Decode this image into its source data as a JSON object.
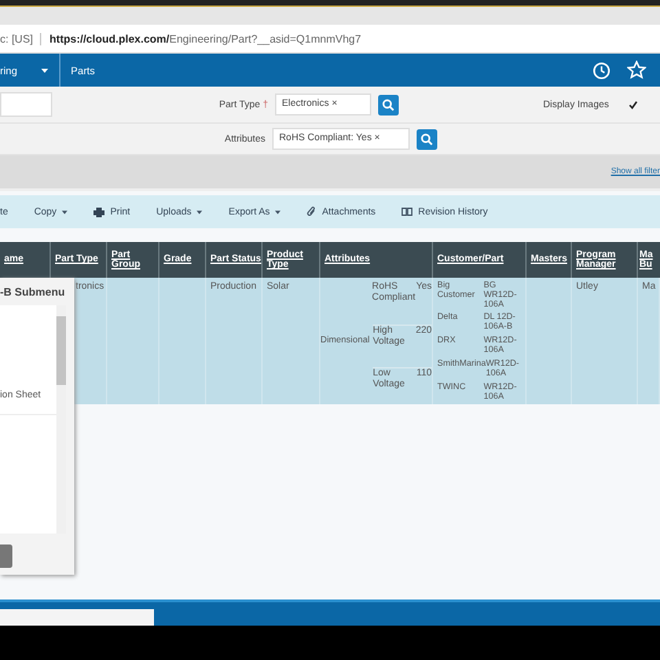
{
  "address_bar": {
    "prefix": "c: [US]",
    "url_host": "https://cloud.plex.com/",
    "url_path": "Engineering/Part?__asid=Q1mnmVhg7"
  },
  "nav": {
    "items": [
      {
        "label": "ring",
        "dropdown": true
      },
      {
        "label": "Parts",
        "dropdown": false
      }
    ]
  },
  "filters": {
    "part_type": {
      "label": "Part Type",
      "required_mark": "†",
      "value": "Electronics",
      "remove_mark": "×"
    },
    "attributes": {
      "label": "Attributes",
      "value": "RoHS Compliant: Yes",
      "remove_mark": "×"
    },
    "display_images": {
      "label": "Display Images",
      "checked": true
    }
  },
  "show_all_filters": "Show all filter",
  "toolbar": [
    {
      "label": "te",
      "dropdown": false,
      "kind": "plain"
    },
    {
      "label": "Copy",
      "dropdown": true,
      "kind": "plain"
    },
    {
      "label": "Print",
      "dropdown": false,
      "kind": "print"
    },
    {
      "label": "Uploads",
      "dropdown": true,
      "kind": "plain"
    },
    {
      "label": "Export As",
      "dropdown": true,
      "kind": "plain"
    },
    {
      "label": "Attachments",
      "dropdown": false,
      "kind": "attach"
    },
    {
      "label": "Revision History",
      "dropdown": false,
      "kind": "history"
    }
  ],
  "table": {
    "columns": [
      "ame",
      "Part Type",
      "Part Group",
      "Grade",
      "Part Status",
      "Product Type",
      "Attributes",
      "Customer/Part",
      "Masters",
      "Program Manager",
      "Ma Bu"
    ],
    "rows": [
      {
        "part_type": "tronics",
        "part_status": "Production",
        "product_type": "Solar",
        "attributes": [
          {
            "name": "RoHS Compliant",
            "value": "Yes"
          },
          {
            "group": "Dimensional",
            "name": "High Voltage",
            "value": "220"
          },
          {
            "name": "Low Voltage",
            "value": "110"
          }
        ],
        "customers": [
          {
            "customer": "Big Customer",
            "part": "BG WR12D-106A"
          },
          {
            "customer": "Delta",
            "part": "DL 12D-106A-B"
          },
          {
            "customer": "DRX",
            "part": "WR12D-106A"
          },
          {
            "customer": "SmithMarina",
            "part": "WR12D-106A"
          },
          {
            "customer": "TWINC",
            "part": "WR12D-106A"
          }
        ],
        "program_manager": "Utley",
        "column_11": "Ma"
      }
    ]
  },
  "submenu": {
    "title": "-B Submenu",
    "items": [
      "ion Sheet"
    ]
  }
}
